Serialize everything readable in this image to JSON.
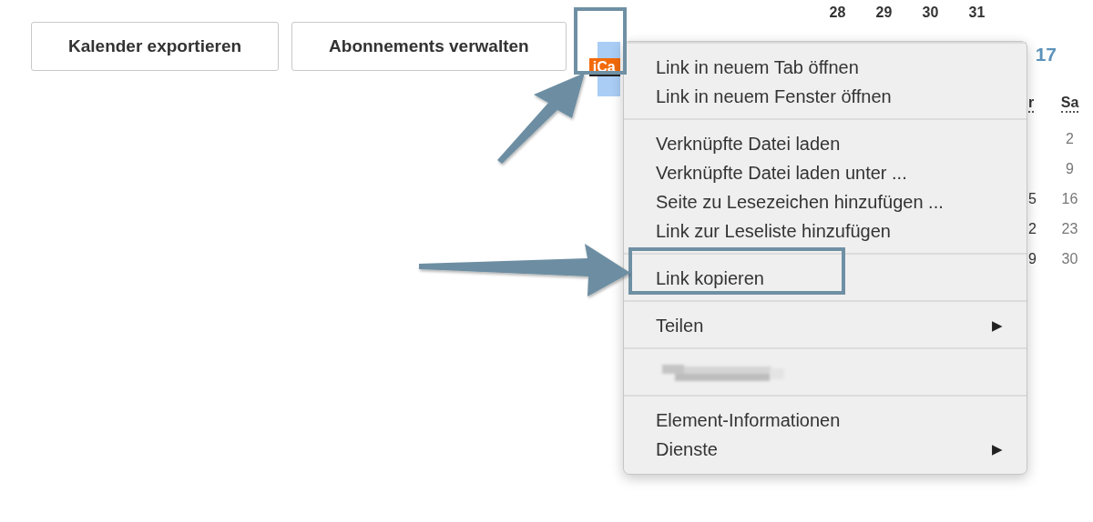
{
  "toolbar": {
    "buttons": [
      "Kalender exportieren",
      "Abonnements verwalten"
    ],
    "ical_link": "iCa"
  },
  "calendar": {
    "title": "17",
    "top_row": [
      "28",
      "29",
      "30",
      "31"
    ],
    "headers": [
      "r",
      "Sa"
    ],
    "rows": [
      {
        "saturday": "2"
      },
      {
        "saturday": "9"
      },
      {
        "friday": "5",
        "saturday": "16"
      },
      {
        "friday": "2",
        "saturday": "23"
      },
      {
        "friday": "9",
        "saturday": "30"
      }
    ]
  },
  "context_menu": {
    "groups": [
      {
        "items": [
          {
            "kind": "entry",
            "label": "Link in neuem Tab öffnen"
          },
          {
            "kind": "entry",
            "label": "Link in neuem Fenster öffnen"
          }
        ]
      },
      {
        "items": [
          {
            "kind": "entry",
            "label": "Verknüpfte Datei laden"
          },
          {
            "kind": "entry",
            "label": "Verknüpfte Datei laden unter ..."
          },
          {
            "kind": "entry",
            "label": "Seite zu Lesezeichen hinzufügen ..."
          },
          {
            "kind": "entry",
            "label": "Link zur Leseliste hinzufügen"
          }
        ]
      },
      {
        "items": [
          {
            "kind": "entry",
            "label": "Link kopieren"
          }
        ]
      },
      {
        "items": [
          {
            "kind": "entry",
            "label": "Teilen",
            "submenu_arrow": "▶"
          }
        ]
      },
      {
        "items": [
          {
            "kind": "redacted"
          }
        ]
      },
      {
        "items": [
          {
            "kind": "entry",
            "label": "Element-Informationen"
          },
          {
            "kind": "entry",
            "label": "Dienste",
            "submenu_arrow": "▶"
          }
        ]
      }
    ]
  }
}
